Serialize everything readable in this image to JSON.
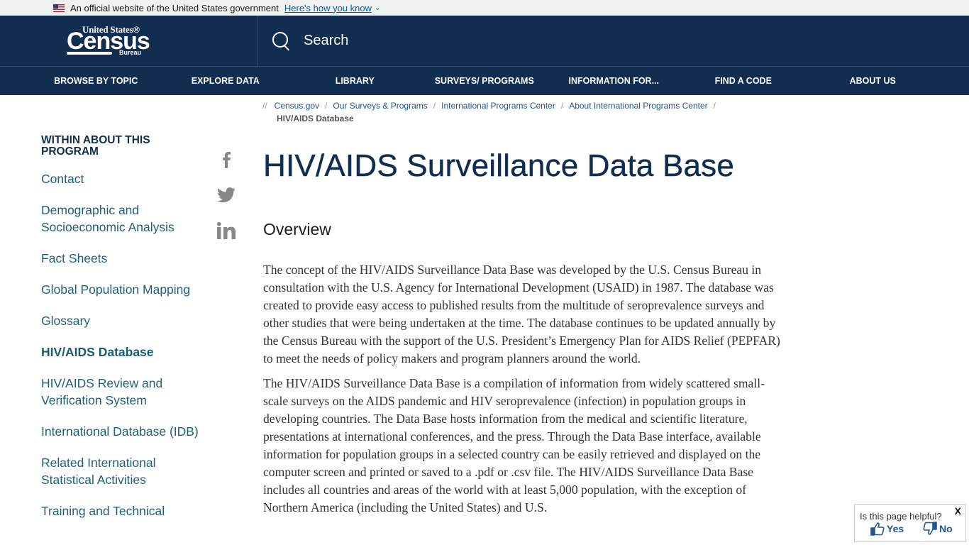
{
  "gov_banner": {
    "flag_icon": "us-flag-icon",
    "text": "An official website of the United States government",
    "how_link": "Here's how you know",
    "chevron": "⌄"
  },
  "header": {
    "logo": {
      "top": "United States®",
      "main": "Census",
      "bottom": "Bureau"
    },
    "search_label": "Search"
  },
  "nav": {
    "items": [
      {
        "label": "BROWSE BY TOPIC"
      },
      {
        "label": "EXPLORE DATA"
      },
      {
        "label": "LIBRARY"
      },
      {
        "label": "SURVEYS/ PROGRAMS"
      },
      {
        "label": "INFORMATION FOR..."
      },
      {
        "label": "FIND A CODE"
      },
      {
        "label": "ABOUT US"
      }
    ]
  },
  "breadcrumb": {
    "lead": "//",
    "items": [
      {
        "label": "Census.gov"
      },
      {
        "label": "Our Surveys & Programs"
      },
      {
        "label": "International Programs Center"
      },
      {
        "label": "About International Programs Center"
      }
    ],
    "separator": "/",
    "current": "HIV/AIDS Database"
  },
  "sidebar": {
    "heading": "WITHIN ABOUT THIS PROGRAM",
    "items": [
      {
        "label": "Contact"
      },
      {
        "label": "Demographic and Socioeconomic Analysis"
      },
      {
        "label": "Fact Sheets"
      },
      {
        "label": "Global Population Mapping"
      },
      {
        "label": "Glossary"
      },
      {
        "label": "HIV/AIDS Database",
        "active": true
      },
      {
        "label": "HIV/AIDS Review and Verification System"
      },
      {
        "label": "International Database (IDB)"
      },
      {
        "label": "Related International Statistical Activities"
      },
      {
        "label": "Training and Technical"
      }
    ]
  },
  "social": [
    "facebook-icon",
    "twitter-icon",
    "linkedin-icon"
  ],
  "main": {
    "title": "HIV/AIDS Surveillance Data Base",
    "section_heading": "Overview",
    "paragraphs": [
      "The concept of the HIV/AIDS Surveillance Data Base was developed by the U.S. Census Bureau in consultation with the U.S. Agency for International Development (USAID) in 1987. The database was created to provide easy access to published results from the multitude of seroprevalence surveys and other studies that were being undertaken at the time. The database continues to be updated annually by the Census Bureau with the support of the U.S. President’s Emergency Plan for AIDS Relief (PEPFAR) to meet the needs of policy makers and program planners around the world.",
      "The HIV/AIDS Surveillance Data Base is a compilation of information from widely scattered small-scale surveys on the AIDS pandemic and HIV seroprevalence (infection) in population groups in developing countries. The Data Base hosts information from the medical and scientific literature, presentations at international conferences, and the press. Through the Data Base interface, available information for population groups in a selected country can be easily retrieved and displayed on the computer screen and printed or saved to a .pdf or .csv file. The HIV/AIDS Surveillance Data Base includes all countries and areas of the world with at least 5,000 population, with the exception of Northern America (including the United States) and U.S."
    ]
  },
  "feedback": {
    "question": "Is this page helpful?",
    "close": "X",
    "yes": "Yes",
    "no": "No"
  },
  "colors": {
    "header_bg": "#112e51",
    "link": "#205493",
    "sidebar_link": "#1f5f7a"
  }
}
